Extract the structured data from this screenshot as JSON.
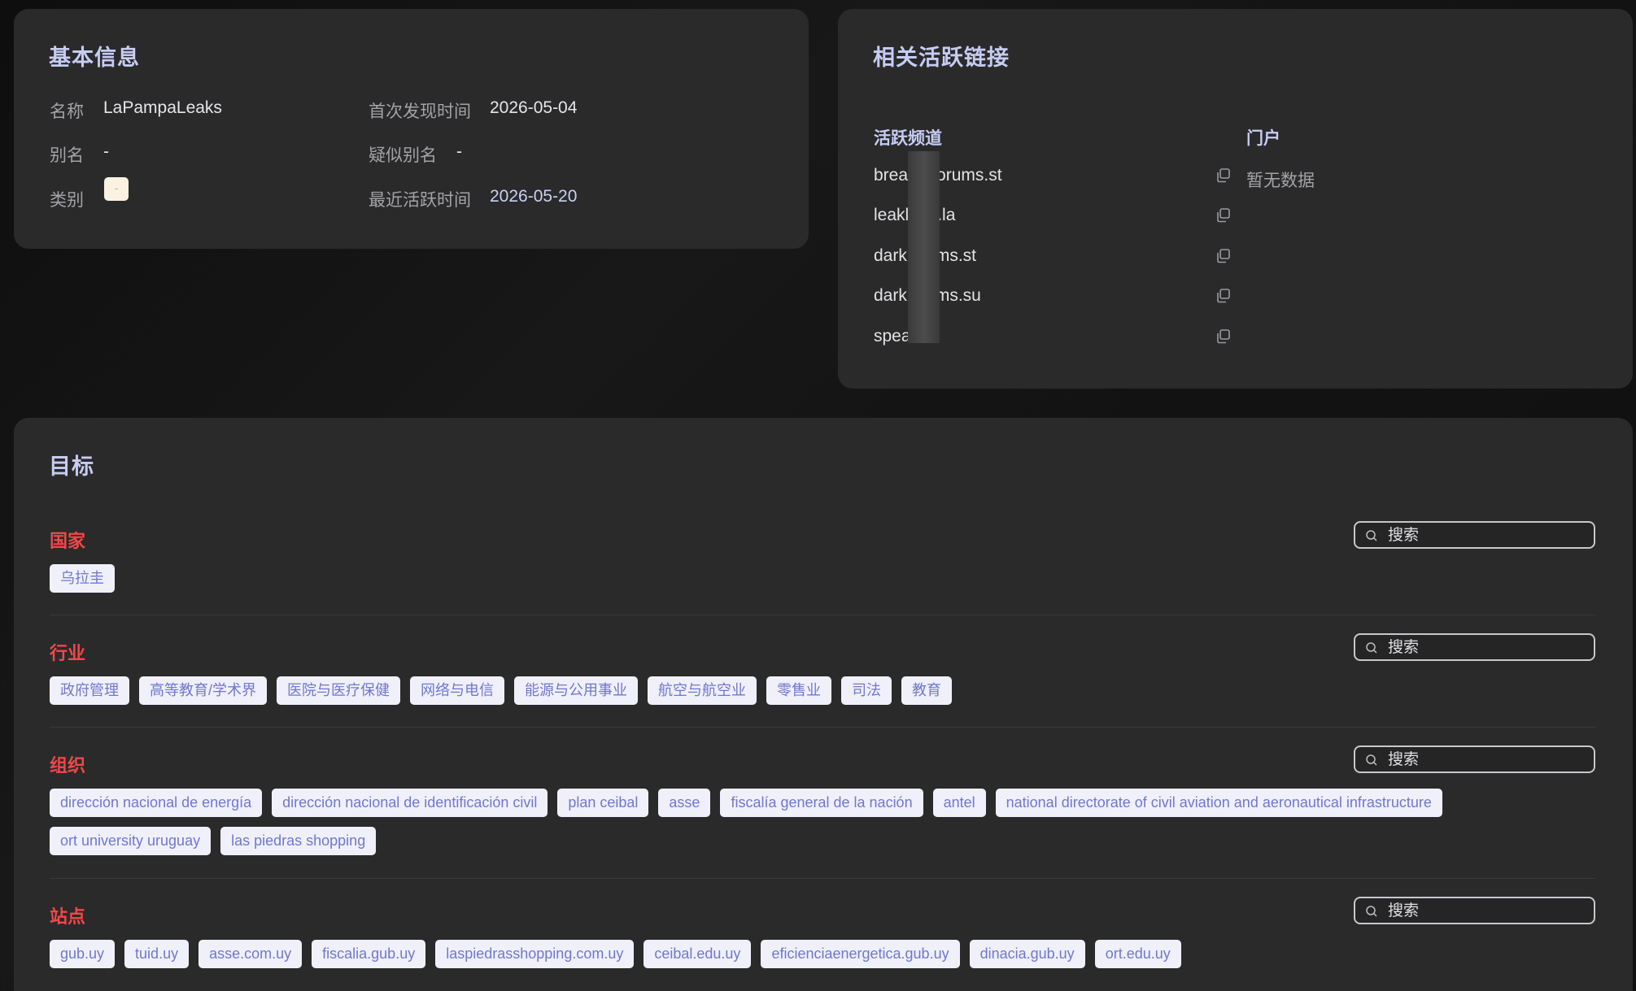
{
  "basic": {
    "title": "基本信息",
    "name_label": "名称",
    "name_value": "LaPampaLeaks",
    "alias_label": "别名",
    "alias_value": "-",
    "category_label": "类别",
    "category_value": "-",
    "first_seen_label": "首次发现时间",
    "first_seen_value": "2026-05-04",
    "suspected_alias_label": "疑似别名",
    "suspected_alias_value": "-",
    "last_active_label": "最近活跃时间",
    "last_active_value": "2026-05-20"
  },
  "links": {
    "title": "相关活跃链接",
    "channels_header": "活跃频道",
    "portal_header": "门户",
    "portal_empty": "暂无数据",
    "channels": [
      {
        "text": "brea      orums.st"
      },
      {
        "text": "leakl      .la"
      },
      {
        "text": "dark      ms.st"
      },
      {
        "text": "dark      ms.su"
      },
      {
        "text": "spea"
      }
    ]
  },
  "targets": {
    "title": "目标",
    "search_placeholder": "搜索",
    "country": {
      "title": "国家",
      "tags": [
        "乌拉圭"
      ]
    },
    "industry": {
      "title": "行业",
      "tags": [
        "政府管理",
        "高等教育/学术界",
        "医院与医疗保健",
        "网络与电信",
        "能源与公用事业",
        "航空与航空业",
        "零售业",
        "司法",
        "教育"
      ]
    },
    "organization": {
      "title": "组织",
      "tags": [
        "dirección nacional de energía",
        "dirección nacional de identificación civil",
        "plan ceibal",
        "asse",
        "fiscalía general de la nación",
        "antel",
        "national directorate of civil aviation and aeronautical infrastructure",
        "ort university uruguay",
        "las piedras shopping"
      ]
    },
    "site": {
      "title": "站点",
      "tags": [
        "gub.uy",
        "tuid.uy",
        "asse.com.uy",
        "fiscalia.gub.uy",
        "laspiedrasshopping.com.uy",
        "ceibal.edu.uy",
        "eficienciaenergetica.gub.uy",
        "dinacia.gub.uy",
        "ort.edu.uy"
      ]
    }
  }
}
